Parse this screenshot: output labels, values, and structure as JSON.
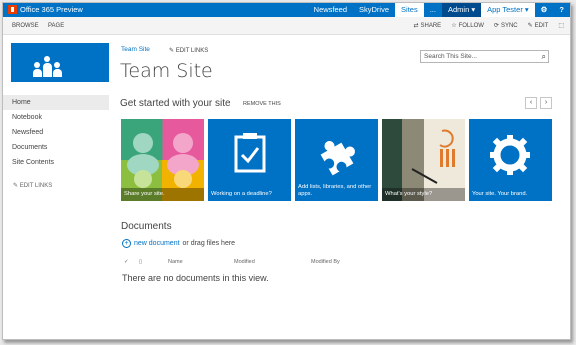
{
  "suite": {
    "brand": "Office 365 Preview",
    "nav": [
      "Newsfeed",
      "SkyDrive",
      "Sites",
      "...",
      "Admin ▾",
      "App Tester ▾"
    ],
    "icons": [
      "gear-icon",
      "help-icon"
    ]
  },
  "ribbon": {
    "tabs": [
      "BROWSE",
      "PAGE"
    ],
    "actions": [
      "SHARE",
      "FOLLOW",
      "SYNC",
      "EDIT"
    ]
  },
  "site": {
    "breadcrumb": "Team Site",
    "edit_links": "EDIT LINKS",
    "title": "Team Site",
    "search_placeholder": "Search This Site..."
  },
  "leftnav": {
    "items": [
      "Home",
      "Notebook",
      "Newsfeed",
      "Documents",
      "Site Contents"
    ],
    "edit_links": "EDIT LINKS"
  },
  "getstarted": {
    "title": "Get started with your site",
    "remove": "REMOVE THIS",
    "tiles": [
      {
        "caption": "Share your site.",
        "color": "#3a9e7c"
      },
      {
        "caption": "Working on a deadline?",
        "color": "#0072c6"
      },
      {
        "caption": "Add lists, libraries, and other apps.",
        "color": "#0072c6"
      },
      {
        "caption": "What's your style?",
        "color": "#6d6a55"
      },
      {
        "caption": "Your site. Your brand.",
        "color": "#0072c6"
      }
    ]
  },
  "documents": {
    "title": "Documents",
    "new_link": "new document",
    "drag_text": "or drag files here",
    "columns": [
      "Name",
      "Modified",
      "Modified By"
    ],
    "empty_text": "There are no documents in this view."
  }
}
